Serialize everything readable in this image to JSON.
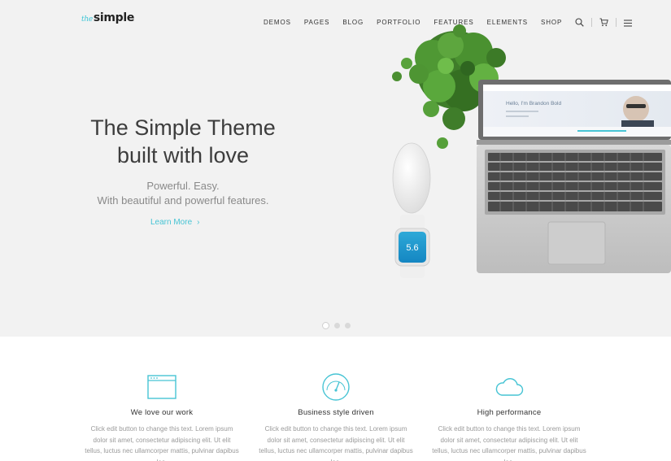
{
  "brand": {
    "prefix": "the",
    "name": "simple"
  },
  "nav": {
    "items": [
      "DEMOS",
      "PAGES",
      "BLOG",
      "PORTFOLIO",
      "FEATURES",
      "ELEMENTS",
      "SHOP"
    ],
    "icons": [
      "search-icon",
      "cart-icon",
      "hamburger-menu-icon"
    ]
  },
  "hero": {
    "title_line1": "The Simple Theme",
    "title_line2": "built with love",
    "subtitle_line1": "Powerful. Easy.",
    "subtitle_line2": "With beautiful and powerful features.",
    "cta": "Learn More",
    "cta_icon": "chevron-right-icon",
    "watch_value": "5.6",
    "screen_headline": "Hello, I'm Brandon Bold",
    "slides_count": 3,
    "active_slide": 1
  },
  "features": [
    {
      "icon": "browser-window-icon",
      "title": "We love our work",
      "body": "Click edit button to change this text. Lorem ipsum dolor sit amet, consectetur adipiscing elit. Ut elit tellus, luctus nec ullamcorper mattis, pulvinar dapibus leo."
    },
    {
      "icon": "speedometer-icon",
      "title": "Business style driven",
      "body": "Click edit button to change this text. Lorem ipsum dolor sit amet, consectetur adipiscing elit. Ut elit tellus, luctus nec ullamcorper mattis, pulvinar dapibus leo."
    },
    {
      "icon": "cloud-icon",
      "title": "High performance",
      "body": "Click edit button to change this text. Lorem ipsum dolor sit amet, consectetur adipiscing elit. Ut elit tellus, luctus nec ullamcorper mattis, pulvinar dapibus leo."
    }
  ],
  "colors": {
    "accent": "#47c4d4",
    "hero_bg": "#f2f2f2",
    "text_dark": "#333333",
    "text_muted": "#9a9a9a"
  }
}
